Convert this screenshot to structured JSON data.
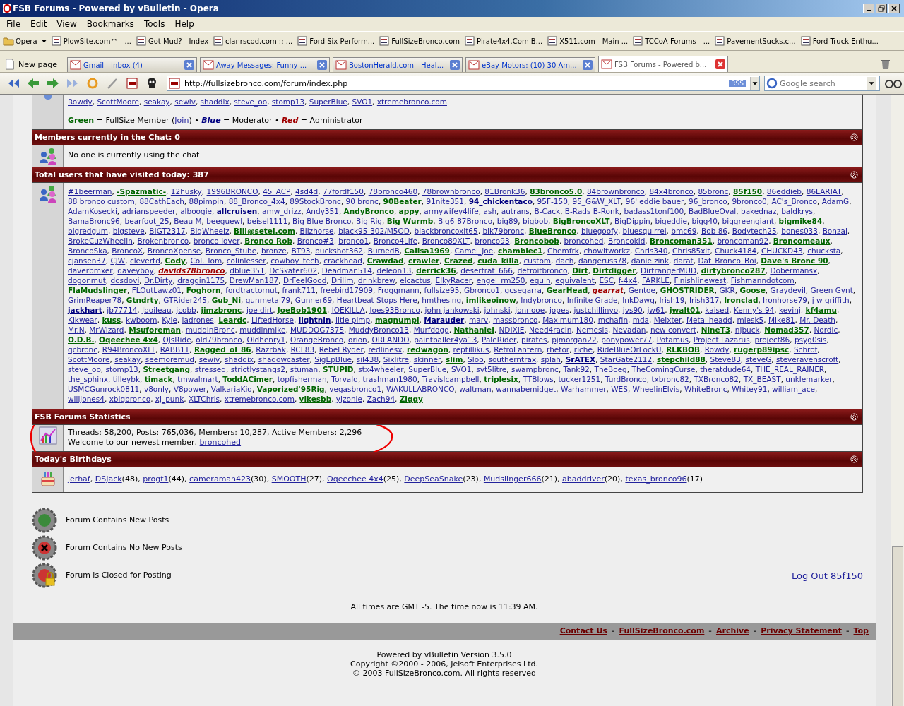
{
  "window": {
    "title": "FSB Forums - Powered by vBulletin - Opera"
  },
  "menu": [
    "File",
    "Edit",
    "View",
    "Bookmarks",
    "Tools",
    "Help"
  ],
  "bookmarks": [
    {
      "label": "Opera",
      "kind": "menu"
    },
    {
      "label": "PlowSite.com™ - ...",
      "kind": "link"
    },
    {
      "label": "Got Mud? - Index",
      "kind": "link"
    },
    {
      "label": "clanrscod.com :: ...",
      "kind": "link"
    },
    {
      "label": "Ford Six Perform...",
      "kind": "link"
    },
    {
      "label": "FullSizeBronco.com",
      "kind": "link"
    },
    {
      "label": "Pirate4x4.Com B...",
      "kind": "link"
    },
    {
      "label": "X511.com - Main ...",
      "kind": "link"
    },
    {
      "label": "TCCoA Forums - ...",
      "kind": "link"
    },
    {
      "label": "PavementSucks.c...",
      "kind": "link"
    },
    {
      "label": "Ford Truck Enthu...",
      "kind": "link"
    }
  ],
  "new_page": "New page",
  "tabs": [
    {
      "label": "Gmail - Inbox (4)",
      "selected": false
    },
    {
      "label": "Away Messages: Funny ...",
      "selected": false
    },
    {
      "label": "BostonHerald.com - Heal...",
      "selected": false
    },
    {
      "label": "eBay Motors: (10) 30 Am...",
      "selected": false
    },
    {
      "label": "FSB Forums - Powered b...",
      "selected": true
    }
  ],
  "address": "http://fullsizebronco.com/forum/index.php",
  "rss": "RSS",
  "search": {
    "placeholder": "Google search"
  },
  "online_tail": {
    "separator": ", ",
    "users": [
      "Rowdy",
      "ScottMoore",
      "seakay",
      "sewiv",
      "shaddix",
      "steve_oo",
      "stomp13",
      "SuperBlue",
      "SVO1",
      "xtremebronco.com"
    ]
  },
  "legend": [
    {
      "text": "Green",
      "kind": "member"
    },
    {
      "text": " = FullSize Member (",
      "kind": "plain"
    },
    {
      "text": "Join",
      "kind": "link"
    },
    {
      "text": ") • ",
      "kind": "plain"
    },
    {
      "text": "Blue",
      "kind": "moderator"
    },
    {
      "text": " = Moderator • ",
      "kind": "plain"
    },
    {
      "text": "Red",
      "kind": "admin"
    },
    {
      "text": " = Administrator",
      "kind": "plain"
    }
  ],
  "chat": {
    "title": "Members currently in the Chat: 0",
    "text": "No one is currently using the chat"
  },
  "visitors": {
    "title": "Total users that have visited today: 387",
    "separator": ", ",
    "users": [
      {
        "name": "#1beerman",
        "kind": "plain"
      },
      {
        "name": "-Spazmatic-",
        "kind": "member"
      },
      {
        "name": "12husky",
        "kind": "plain"
      },
      {
        "name": "1996BRONCO",
        "kind": "plain"
      },
      {
        "name": "45_ACP",
        "kind": "plain"
      },
      {
        "name": "4sd4d",
        "kind": "plain"
      },
      {
        "name": "77fordf150",
        "kind": "plain"
      },
      {
        "name": "78bronco460",
        "kind": "plain"
      },
      {
        "name": "78brownbronco",
        "kind": "plain"
      },
      {
        "name": "81Bronk36",
        "kind": "plain"
      },
      {
        "name": "83bronco5.0",
        "kind": "member"
      },
      {
        "name": "84brownbronco",
        "kind": "plain"
      },
      {
        "name": "84x4bronco",
        "kind": "plain"
      },
      {
        "name": "85bronc",
        "kind": "plain"
      },
      {
        "name": "85f150",
        "kind": "member"
      },
      {
        "name": "86eddieb",
        "kind": "plain"
      },
      {
        "name": "86LARIAT",
        "kind": "plain"
      },
      {
        "name": "88 bronco custom",
        "kind": "plain"
      },
      {
        "name": "88CathEach",
        "kind": "plain"
      },
      {
        "name": "88pimpin",
        "kind": "plain"
      },
      {
        "name": "88_Bronco_4x4",
        "kind": "plain"
      },
      {
        "name": "89StockBronc",
        "kind": "plain"
      },
      {
        "name": "90 bronc",
        "kind": "plain"
      },
      {
        "name": "90Beater",
        "kind": "member"
      },
      {
        "name": "91nite351",
        "kind": "plain"
      },
      {
        "name": "94_chickentaco",
        "kind": "moderator"
      },
      {
        "name": "95F-150",
        "kind": "plain"
      },
      {
        "name": "95_G&W_XLT",
        "kind": "plain"
      },
      {
        "name": "96' eddie bauer",
        "kind": "plain"
      },
      {
        "name": "96_bronco",
        "kind": "plain"
      },
      {
        "name": "9bronco0",
        "kind": "plain"
      },
      {
        "name": "AC's_Bronco",
        "kind": "plain"
      },
      {
        "name": "AdamG",
        "kind": "plain"
      },
      {
        "name": "AdamKosecki",
        "kind": "plain"
      },
      {
        "name": "adrianspeeder",
        "kind": "plain"
      },
      {
        "name": "alboogie",
        "kind": "plain"
      },
      {
        "name": "allcruisen",
        "kind": "moderator"
      },
      {
        "name": "amw_drizz",
        "kind": "plain"
      },
      {
        "name": "Andy351",
        "kind": "plain"
      },
      {
        "name": "AndyBronco",
        "kind": "member"
      },
      {
        "name": "appy",
        "kind": "member"
      },
      {
        "name": "armywifey4life",
        "kind": "plain"
      },
      {
        "name": "ash",
        "kind": "plain"
      },
      {
        "name": "autrans",
        "kind": "plain"
      },
      {
        "name": "B-Cack",
        "kind": "plain"
      },
      {
        "name": "B-Rads B-Ronk",
        "kind": "plain"
      },
      {
        "name": "badass1tonf100",
        "kind": "plain"
      },
      {
        "name": "BadBlueOval",
        "kind": "plain"
      },
      {
        "name": "bakednaz",
        "kind": "plain"
      },
      {
        "name": "baldkrys",
        "kind": "plain"
      },
      {
        "name": "BamaBronc96",
        "kind": "plain"
      },
      {
        "name": "bearfoot_25",
        "kind": "plain"
      },
      {
        "name": "Beau M",
        "kind": "plain"
      },
      {
        "name": "beeguewl",
        "kind": "plain"
      },
      {
        "name": "beisel1111",
        "kind": "plain"
      },
      {
        "name": "Big Blue Bronco",
        "kind": "plain"
      },
      {
        "name": "Big Rig",
        "kind": "plain"
      },
      {
        "name": "Big Wurmb",
        "kind": "member"
      },
      {
        "name": "Big6-87Bronco",
        "kind": "plain"
      },
      {
        "name": "big89",
        "kind": "plain"
      },
      {
        "name": "bigbob",
        "kind": "plain"
      },
      {
        "name": "BigBroncoXLT",
        "kind": "member"
      },
      {
        "name": "BigDippin",
        "kind": "plain"
      },
      {
        "name": "bigeddie",
        "kind": "plain"
      },
      {
        "name": "bigg40",
        "kind": "plain"
      },
      {
        "name": "biggreengiant",
        "kind": "plain"
      },
      {
        "name": "bigmike84",
        "kind": "member"
      },
      {
        "name": "bigredgum",
        "kind": "plain"
      },
      {
        "name": "bigsteve",
        "kind": "plain"
      },
      {
        "name": "BIGT2317",
        "kind": "plain"
      },
      {
        "name": "BigWheelz",
        "kind": "plain"
      },
      {
        "name": "Bill@setel.com",
        "kind": "member"
      },
      {
        "name": "Bilzhorse",
        "kind": "plain"
      },
      {
        "name": "black95-302/M5OD",
        "kind": "plain"
      },
      {
        "name": "blackbroncoxlt65",
        "kind": "plain"
      },
      {
        "name": "blk79bronc",
        "kind": "plain"
      },
      {
        "name": "BlueBronco",
        "kind": "member"
      },
      {
        "name": "bluegoofy",
        "kind": "plain"
      },
      {
        "name": "bluesquirrel",
        "kind": "plain"
      },
      {
        "name": "bmc69",
        "kind": "plain"
      },
      {
        "name": "Bob 86",
        "kind": "plain"
      },
      {
        "name": "Bodytech25",
        "kind": "plain"
      },
      {
        "name": "bones033",
        "kind": "plain"
      },
      {
        "name": "Bonzai",
        "kind": "plain"
      },
      {
        "name": "BrokeCuzWheelin",
        "kind": "plain"
      },
      {
        "name": "Brokenbronco",
        "kind": "plain"
      },
      {
        "name": "bronco lover",
        "kind": "plain"
      },
      {
        "name": "Bronco Rob",
        "kind": "member"
      },
      {
        "name": "Bronco#3",
        "kind": "plain"
      },
      {
        "name": "bronco1",
        "kind": "plain"
      },
      {
        "name": "Bronco4Life",
        "kind": "plain"
      },
      {
        "name": "Bronco89XLT",
        "kind": "plain"
      },
      {
        "name": "bronco93",
        "kind": "plain"
      },
      {
        "name": "Broncobob",
        "kind": "member"
      },
      {
        "name": "broncohed",
        "kind": "plain"
      },
      {
        "name": "Broncokid",
        "kind": "plain"
      },
      {
        "name": "Broncoman351",
        "kind": "member"
      },
      {
        "name": "broncoman92",
        "kind": "plain"
      },
      {
        "name": "Broncomeaux",
        "kind": "member"
      },
      {
        "name": "BroncoSka",
        "kind": "plain"
      },
      {
        "name": "BroncoX",
        "kind": "plain"
      },
      {
        "name": "BroncoXpense",
        "kind": "plain"
      },
      {
        "name": "Bronco_Stube",
        "kind": "plain"
      },
      {
        "name": "bronze",
        "kind": "plain"
      },
      {
        "name": "BT93",
        "kind": "plain"
      },
      {
        "name": "buckshot362",
        "kind": "plain"
      },
      {
        "name": "BurnedB",
        "kind": "plain"
      },
      {
        "name": "Calisa1969",
        "kind": "member"
      },
      {
        "name": "Camel_Joe",
        "kind": "plain"
      },
      {
        "name": "chambiec1",
        "kind": "member"
      },
      {
        "name": "Chemfrk",
        "kind": "plain"
      },
      {
        "name": "chowitworkz",
        "kind": "plain"
      },
      {
        "name": "Chris340",
        "kind": "plain"
      },
      {
        "name": "Chris85xlt",
        "kind": "plain"
      },
      {
        "name": "Chuck4184",
        "kind": "plain"
      },
      {
        "name": "CHUCKD43",
        "kind": "plain"
      },
      {
        "name": "chucksta",
        "kind": "plain"
      },
      {
        "name": "cjansen37",
        "kind": "plain"
      },
      {
        "name": "CJW",
        "kind": "plain"
      },
      {
        "name": "clevertd",
        "kind": "plain"
      },
      {
        "name": "Cody",
        "kind": "member"
      },
      {
        "name": "Col. Tom",
        "kind": "plain"
      },
      {
        "name": "colinlesser",
        "kind": "plain"
      },
      {
        "name": "cowboy_tech",
        "kind": "plain"
      },
      {
        "name": "crackhead",
        "kind": "plain"
      },
      {
        "name": "Crawdad",
        "kind": "member"
      },
      {
        "name": "crawler",
        "kind": "member"
      },
      {
        "name": "Crazed",
        "kind": "member"
      },
      {
        "name": "cuda_killa",
        "kind": "member"
      },
      {
        "name": "custom",
        "kind": "plain"
      },
      {
        "name": "dach",
        "kind": "plain"
      },
      {
        "name": "dangeruss78",
        "kind": "plain"
      },
      {
        "name": "danielzink",
        "kind": "plain"
      },
      {
        "name": "darat",
        "kind": "plain"
      },
      {
        "name": "Dat_Bronco_Boi",
        "kind": "plain"
      },
      {
        "name": "Dave's Bronc 90",
        "kind": "member"
      },
      {
        "name": "daverbmxer",
        "kind": "plain"
      },
      {
        "name": "daveyboy",
        "kind": "plain"
      },
      {
        "name": "davids78bronco",
        "kind": "admin"
      },
      {
        "name": "dblue351",
        "kind": "plain"
      },
      {
        "name": "DcSkater602",
        "kind": "plain"
      },
      {
        "name": "Deadman514",
        "kind": "plain"
      },
      {
        "name": "deleon13",
        "kind": "plain"
      },
      {
        "name": "derrick36",
        "kind": "member"
      },
      {
        "name": "desertrat_666",
        "kind": "plain"
      },
      {
        "name": "detroitbronco",
        "kind": "plain"
      },
      {
        "name": "Dirt",
        "kind": "member"
      },
      {
        "name": "Dirtdigger",
        "kind": "member"
      },
      {
        "name": "DirtrangerMUD",
        "kind": "plain"
      },
      {
        "name": "dirtybronco287",
        "kind": "member"
      },
      {
        "name": "Dobermansx",
        "kind": "plain"
      },
      {
        "name": "dogonmut",
        "kind": "plain"
      },
      {
        "name": "dosdovi",
        "kind": "plain"
      },
      {
        "name": "Dr.Dirty",
        "kind": "plain"
      },
      {
        "name": "draggin1175",
        "kind": "plain"
      },
      {
        "name": "DrewMan187",
        "kind": "plain"
      },
      {
        "name": "DrFeelGood",
        "kind": "plain"
      },
      {
        "name": "Drilim",
        "kind": "plain"
      },
      {
        "name": "drinkbrew",
        "kind": "plain"
      },
      {
        "name": "elcactus",
        "kind": "plain"
      },
      {
        "name": "ElkyRacer",
        "kind": "plain"
      },
      {
        "name": "engel_rm250",
        "kind": "plain"
      },
      {
        "name": "equin",
        "kind": "plain"
      },
      {
        "name": "equivalent",
        "kind": "plain"
      },
      {
        "name": "ESC",
        "kind": "plain"
      },
      {
        "name": "f-4x4",
        "kind": "plain"
      },
      {
        "name": "FARKLE",
        "kind": "plain"
      },
      {
        "name": "Finishlinewest",
        "kind": "plain"
      },
      {
        "name": "Fishmanndotcom",
        "kind": "plain"
      },
      {
        "name": "FlaMudslinger",
        "kind": "member"
      },
      {
        "name": "FLOutLawz01",
        "kind": "plain"
      },
      {
        "name": "Foghorn",
        "kind": "member"
      },
      {
        "name": "fordtractornut",
        "kind": "plain"
      },
      {
        "name": "frank711",
        "kind": "plain"
      },
      {
        "name": "freebird17909",
        "kind": "plain"
      },
      {
        "name": "Froggmann",
        "kind": "plain"
      },
      {
        "name": "fullsize95",
        "kind": "plain"
      },
      {
        "name": "Gbronco1",
        "kind": "plain"
      },
      {
        "name": "gcsegarra",
        "kind": "plain"
      },
      {
        "name": "GearHead",
        "kind": "member"
      },
      {
        "name": "gearrat",
        "kind": "admin"
      },
      {
        "name": "Gentoe",
        "kind": "plain"
      },
      {
        "name": "GHOSTRIDER",
        "kind": "member"
      },
      {
        "name": "GKR",
        "kind": "plain"
      },
      {
        "name": "Goose",
        "kind": "member"
      },
      {
        "name": "Graydevil",
        "kind": "plain"
      },
      {
        "name": "Green Gynt",
        "kind": "plain"
      },
      {
        "name": "GrimReaper78",
        "kind": "plain"
      },
      {
        "name": "Gtndrty",
        "kind": "member"
      },
      {
        "name": "GTRider245",
        "kind": "plain"
      },
      {
        "name": "Gub_Ni",
        "kind": "member"
      },
      {
        "name": "gunmetal79",
        "kind": "plain"
      },
      {
        "name": "Gunner69",
        "kind": "plain"
      },
      {
        "name": "Heartbeat Stops Here",
        "kind": "plain"
      },
      {
        "name": "hmthesing",
        "kind": "plain"
      },
      {
        "name": "imlikeoinow",
        "kind": "member"
      },
      {
        "name": "Indybronco",
        "kind": "plain"
      },
      {
        "name": "Infinite Grade",
        "kind": "plain"
      },
      {
        "name": "InkDawg",
        "kind": "plain"
      },
      {
        "name": "Irish19",
        "kind": "plain"
      },
      {
        "name": "Irish317",
        "kind": "plain"
      },
      {
        "name": "Ironclad",
        "kind": "member"
      },
      {
        "name": "Ironhorse79",
        "kind": "plain"
      },
      {
        "name": "j w griffith",
        "kind": "plain"
      },
      {
        "name": "jackhart",
        "kind": "moderator"
      },
      {
        "name": "jb77714",
        "kind": "plain"
      },
      {
        "name": "Jboileau",
        "kind": "plain"
      },
      {
        "name": "jcobb",
        "kind": "plain"
      },
      {
        "name": "jimzbronc",
        "kind": "member"
      },
      {
        "name": "joe dirt",
        "kind": "plain"
      },
      {
        "name": "JoeBob1901",
        "kind": "member"
      },
      {
        "name": "JOEKILLA",
        "kind": "plain"
      },
      {
        "name": "Joes93Bronco",
        "kind": "plain"
      },
      {
        "name": "john jankowski",
        "kind": "plain"
      },
      {
        "name": "johnski",
        "kind": "plain"
      },
      {
        "name": "jonnooe",
        "kind": "plain"
      },
      {
        "name": "jopes",
        "kind": "plain"
      },
      {
        "name": "justchillinyo",
        "kind": "plain"
      },
      {
        "name": "jvs90",
        "kind": "plain"
      },
      {
        "name": "jw61",
        "kind": "plain"
      },
      {
        "name": "jwalt01",
        "kind": "member"
      },
      {
        "name": "kaised",
        "kind": "plain"
      },
      {
        "name": "Kenny's 94",
        "kind": "plain"
      },
      {
        "name": "kevinj",
        "kind": "plain"
      },
      {
        "name": "kf4amu",
        "kind": "member"
      },
      {
        "name": "Kikwear",
        "kind": "plain"
      },
      {
        "name": "kuss",
        "kind": "member"
      },
      {
        "name": "kwboom",
        "kind": "plain"
      },
      {
        "name": "Kyle",
        "kind": "plain"
      },
      {
        "name": "ladrones",
        "kind": "plain"
      },
      {
        "name": "Leardc",
        "kind": "member"
      },
      {
        "name": "LiftedHorse",
        "kind": "plain"
      },
      {
        "name": "lightnin",
        "kind": "moderator"
      },
      {
        "name": "litle pimp",
        "kind": "plain"
      },
      {
        "name": "magnumpi",
        "kind": "member"
      },
      {
        "name": "Marauder",
        "kind": "moderator"
      },
      {
        "name": "marv",
        "kind": "plain"
      },
      {
        "name": "massbronco",
        "kind": "plain"
      },
      {
        "name": "Maximum180",
        "kind": "plain"
      },
      {
        "name": "mchafin",
        "kind": "plain"
      },
      {
        "name": "mda",
        "kind": "plain"
      },
      {
        "name": "Meixter",
        "kind": "plain"
      },
      {
        "name": "Metallheadd",
        "kind": "plain"
      },
      {
        "name": "miesk5",
        "kind": "plain"
      },
      {
        "name": "Mike81",
        "kind": "plain"
      },
      {
        "name": "Mr. Death",
        "kind": "plain"
      },
      {
        "name": "Mr.N",
        "kind": "plain"
      },
      {
        "name": "MrWizard",
        "kind": "plain"
      },
      {
        "name": "Msuforeman",
        "kind": "member"
      },
      {
        "name": "muddinBronc",
        "kind": "plain"
      },
      {
        "name": "muddinmike",
        "kind": "plain"
      },
      {
        "name": "MUDDOG7375",
        "kind": "plain"
      },
      {
        "name": "MuddyBronco13",
        "kind": "plain"
      },
      {
        "name": "Murfdogg",
        "kind": "plain"
      },
      {
        "name": "Nathaniel",
        "kind": "member"
      },
      {
        "name": "NDIXIE",
        "kind": "plain"
      },
      {
        "name": "Need4racin",
        "kind": "plain"
      },
      {
        "name": "Nemesis",
        "kind": "plain"
      },
      {
        "name": "Nevadan",
        "kind": "plain"
      },
      {
        "name": "new convert",
        "kind": "plain"
      },
      {
        "name": "NineT3",
        "kind": "member"
      },
      {
        "name": "njbuck",
        "kind": "plain"
      },
      {
        "name": "Nomad357",
        "kind": "member"
      },
      {
        "name": "Nordic",
        "kind": "plain"
      },
      {
        "name": "O.D.B.",
        "kind": "member"
      },
      {
        "name": "Oqeechee 4x4",
        "kind": "member"
      },
      {
        "name": "OJsRide",
        "kind": "plain"
      },
      {
        "name": "old79bronco",
        "kind": "plain"
      },
      {
        "name": "Oldhenry1",
        "kind": "plain"
      },
      {
        "name": "OrangeBronco",
        "kind": "plain"
      },
      {
        "name": "orion",
        "kind": "plain"
      },
      {
        "name": "ORLANDO",
        "kind": "plain"
      },
      {
        "name": "paintballer4ya13",
        "kind": "plain"
      },
      {
        "name": "PaleRider",
        "kind": "plain"
      },
      {
        "name": "pirates",
        "kind": "plain"
      },
      {
        "name": "pjmorgan22",
        "kind": "plain"
      },
      {
        "name": "ponypower77",
        "kind": "plain"
      },
      {
        "name": "Potamus",
        "kind": "plain"
      },
      {
        "name": "Project Lazarus",
        "kind": "plain"
      },
      {
        "name": "project86",
        "kind": "plain"
      },
      {
        "name": "psyg0sis",
        "kind": "plain"
      },
      {
        "name": "qcbronc",
        "kind": "plain"
      },
      {
        "name": "R94BroncoXLT",
        "kind": "plain"
      },
      {
        "name": "RABB1T",
        "kind": "plain"
      },
      {
        "name": "Ragged_ol_86",
        "kind": "member"
      },
      {
        "name": "Razrbak",
        "kind": "plain"
      },
      {
        "name": "RCF83",
        "kind": "plain"
      },
      {
        "name": "Rebel Ryder",
        "kind": "plain"
      },
      {
        "name": "redlinesx",
        "kind": "plain"
      },
      {
        "name": "redwagon",
        "kind": "member"
      },
      {
        "name": "reptillikus",
        "kind": "plain"
      },
      {
        "name": "RetroLantern",
        "kind": "plain"
      },
      {
        "name": "rhetor",
        "kind": "plain"
      },
      {
        "name": "riche",
        "kind": "plain"
      },
      {
        "name": "RideBlueOrFockU",
        "kind": "plain"
      },
      {
        "name": "RLKBOB",
        "kind": "member"
      },
      {
        "name": "Rowdy",
        "kind": "plain"
      },
      {
        "name": "rugerp89ipsc",
        "kind": "member"
      },
      {
        "name": "Schrof",
        "kind": "plain"
      },
      {
        "name": "ScottMoore",
        "kind": "plain"
      },
      {
        "name": "seakay",
        "kind": "plain"
      },
      {
        "name": "seemoremud",
        "kind": "plain"
      },
      {
        "name": "sewiv",
        "kind": "plain"
      },
      {
        "name": "shaddix",
        "kind": "plain"
      },
      {
        "name": "shadowcaster",
        "kind": "plain"
      },
      {
        "name": "SigEpBlue",
        "kind": "plain"
      },
      {
        "name": "sil438",
        "kind": "plain"
      },
      {
        "name": "Sixlitre",
        "kind": "plain"
      },
      {
        "name": "skinner",
        "kind": "plain"
      },
      {
        "name": "slim",
        "kind": "member"
      },
      {
        "name": "Slob",
        "kind": "plain"
      },
      {
        "name": "southerntrax",
        "kind": "plain"
      },
      {
        "name": "splah",
        "kind": "plain"
      },
      {
        "name": "SrATEX",
        "kind": "moderator"
      },
      {
        "name": "StarGate2112",
        "kind": "plain"
      },
      {
        "name": "stepchild88",
        "kind": "member"
      },
      {
        "name": "Steve83",
        "kind": "plain"
      },
      {
        "name": "steveG",
        "kind": "plain"
      },
      {
        "name": "steveravenscroft",
        "kind": "plain"
      },
      {
        "name": "steve_oo",
        "kind": "plain"
      },
      {
        "name": "stomp13",
        "kind": "plain"
      },
      {
        "name": "Streetgang",
        "kind": "member"
      },
      {
        "name": "stressed",
        "kind": "plain"
      },
      {
        "name": "strictlystangs2",
        "kind": "plain"
      },
      {
        "name": "stuman",
        "kind": "plain"
      },
      {
        "name": "STUPID",
        "kind": "member"
      },
      {
        "name": "stx4wheeler",
        "kind": "plain"
      },
      {
        "name": "SuperBlue",
        "kind": "plain"
      },
      {
        "name": "SVO1",
        "kind": "plain"
      },
      {
        "name": "svt5litre",
        "kind": "plain"
      },
      {
        "name": "swampbronc",
        "kind": "plain"
      },
      {
        "name": "Tank92",
        "kind": "plain"
      },
      {
        "name": "TheBoeg",
        "kind": "plain"
      },
      {
        "name": "TheComingCurse",
        "kind": "plain"
      },
      {
        "name": "theratdude64",
        "kind": "plain"
      },
      {
        "name": "THE_REAL_RAINER",
        "kind": "plain"
      },
      {
        "name": "the_sphinx",
        "kind": "plain"
      },
      {
        "name": "tilleybk",
        "kind": "plain"
      },
      {
        "name": "timack",
        "kind": "member"
      },
      {
        "name": "tmwalmart",
        "kind": "plain"
      },
      {
        "name": "ToddACimer",
        "kind": "member"
      },
      {
        "name": "topfisherman",
        "kind": "plain"
      },
      {
        "name": "Torvald",
        "kind": "plain"
      },
      {
        "name": "trashman1980",
        "kind": "plain"
      },
      {
        "name": "Travislcampbell",
        "kind": "plain"
      },
      {
        "name": "triplesix",
        "kind": "member"
      },
      {
        "name": "TTBlows",
        "kind": "plain"
      },
      {
        "name": "tucker1251",
        "kind": "plain"
      },
      {
        "name": "TurdBronco",
        "kind": "plain"
      },
      {
        "name": "txbronc82",
        "kind": "plain"
      },
      {
        "name": "TXBronco82",
        "kind": "plain"
      },
      {
        "name": "TX_BEAST",
        "kind": "plain"
      },
      {
        "name": "unklemarker",
        "kind": "plain"
      },
      {
        "name": "USMCGunrock0811",
        "kind": "plain"
      },
      {
        "name": "v8only",
        "kind": "plain"
      },
      {
        "name": "V8power",
        "kind": "plain"
      },
      {
        "name": "ValkariaKid",
        "kind": "plain"
      },
      {
        "name": "Vaporized'95Rig",
        "kind": "member"
      },
      {
        "name": "vegasbronco1",
        "kind": "plain"
      },
      {
        "name": "WAKULLABRONCO",
        "kind": "plain"
      },
      {
        "name": "waltman",
        "kind": "plain"
      },
      {
        "name": "wannabemidget",
        "kind": "plain"
      },
      {
        "name": "Warhammer",
        "kind": "plain"
      },
      {
        "name": "WES",
        "kind": "plain"
      },
      {
        "name": "WheelinElvis",
        "kind": "plain"
      },
      {
        "name": "WhiteBronc",
        "kind": "plain"
      },
      {
        "name": "Whitey91",
        "kind": "plain"
      },
      {
        "name": "william_ace",
        "kind": "plain"
      },
      {
        "name": "willjones4",
        "kind": "plain"
      },
      {
        "name": "xbigbronco",
        "kind": "plain"
      },
      {
        "name": "xj_punk",
        "kind": "plain"
      },
      {
        "name": "XLTChris",
        "kind": "plain"
      },
      {
        "name": "xtremebronco.com",
        "kind": "plain"
      },
      {
        "name": "yikesbb",
        "kind": "member"
      },
      {
        "name": "yjzonie",
        "kind": "plain"
      },
      {
        "name": "Zach94",
        "kind": "plain"
      },
      {
        "name": "Ziggy",
        "kind": "member"
      }
    ]
  },
  "stats": {
    "title": "FSB Forums Statistics",
    "line": "Threads: 58,200, Posts: 765,036, Members: 10,287, Active Members: 2,296",
    "welcome": "Welcome to our newest member, ",
    "newest": "broncohed"
  },
  "birthdays": {
    "title": "Today's Birthdays",
    "separator": ", ",
    "people": [
      {
        "name": "jerhaf"
      },
      {
        "name": "DSJack",
        "age": "(48)"
      },
      {
        "name": "progt1",
        "age": "(44)"
      },
      {
        "name": "cameraman423",
        "age": "(30)"
      },
      {
        "name": "SMOOTH",
        "age": "(27)"
      },
      {
        "name": "Oqeechee 4x4",
        "age": "(25)"
      },
      {
        "name": "DeepSeaSnake",
        "age": "(23)"
      },
      {
        "name": "Mudslinger666",
        "age": "(21)"
      },
      {
        "name": "abaddriver",
        "age": "(20)"
      },
      {
        "name": "texas_bronco96",
        "age": "(17)"
      }
    ]
  },
  "forum_icons": [
    {
      "kind": "new",
      "label": "Forum Contains New Posts"
    },
    {
      "kind": "none",
      "label": "Forum Contains No New Posts"
    },
    {
      "kind": "closed",
      "label": "Forum is Closed for Posting"
    }
  ],
  "logout": "Log Out 85f150",
  "times": "All times are GMT -5. The time now is 11:39 AM.",
  "footer_separator": "-",
  "footer_links": [
    "Contact Us",
    "FullSizeBronco.com",
    "Archive",
    "Privacy Statement",
    "Top"
  ],
  "credits": [
    "Powered by vBulletin Version 3.5.0",
    "Copyright ©2000 - 2006, Jelsoft Enterprises Ltd.",
    "© 2003 FullSizeBronco.com. All rights reserved"
  ]
}
